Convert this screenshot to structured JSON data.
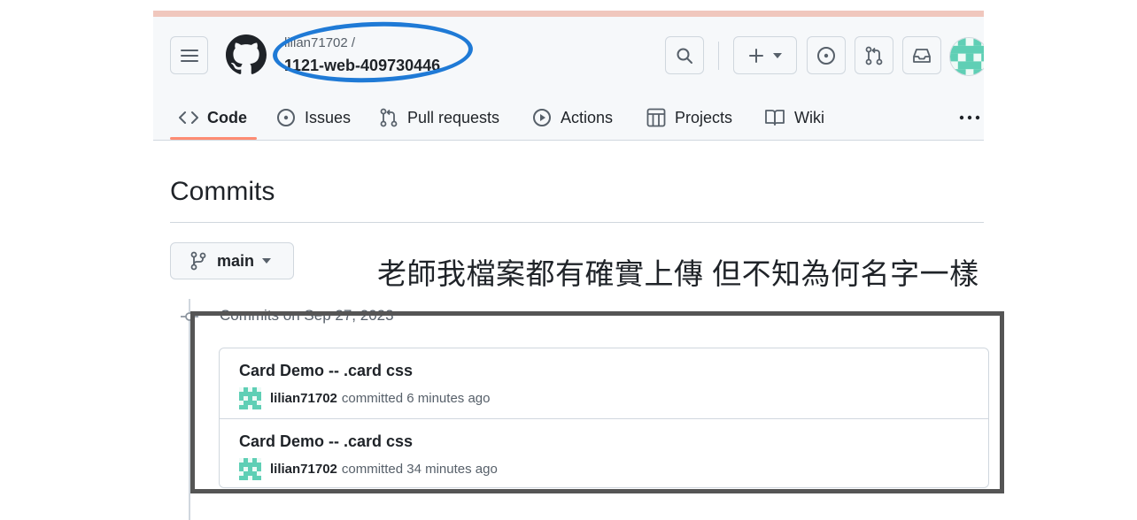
{
  "header": {
    "owner": "lilian71702 /",
    "repo": "1121-web-409730446"
  },
  "tabs": [
    {
      "label": "Code"
    },
    {
      "label": "Issues"
    },
    {
      "label": "Pull requests"
    },
    {
      "label": "Actions"
    },
    {
      "label": "Projects"
    },
    {
      "label": "Wiki"
    }
  ],
  "page": {
    "title": "Commits",
    "branch": "main",
    "date_heading": "Commits on Sep 27, 2023"
  },
  "annotation": {
    "text": "老師我檔案都有確實上傳 但不知為何名字一樣"
  },
  "commits": [
    {
      "title": "Card Demo -- .card css",
      "author": "lilian71702",
      "action": "committed",
      "time": "6 minutes ago"
    },
    {
      "title": "Card Demo -- .card css",
      "author": "lilian71702",
      "action": "committed",
      "time": "34 minutes ago"
    }
  ],
  "colors": {
    "accent_underline": "#fd8c73",
    "annotation_circle": "#1f7ad6",
    "annotation_box": "#555555",
    "avatar": "#5fcfb5"
  }
}
